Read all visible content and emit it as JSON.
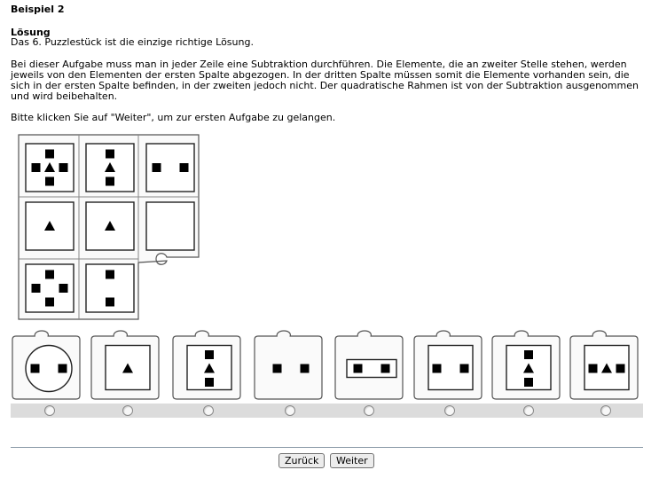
{
  "header": {
    "title": "Beispiel 2"
  },
  "solution": {
    "heading": "Lösung",
    "text": "Das 6. Puzzlestück ist die einzige richtige Lösung."
  },
  "explanation": "Bei dieser Aufgabe muss man in jeder Zeile eine Subtraktion durchführen. Die Elemente, die an zweiter Stelle stehen, werden jeweils von den Elementen der ersten Spalte abgezogen. In der dritten Spalte müssen somit die Elemente vorhanden sein, die sich in der ersten Spalte befinden, in der zweiten jedoch nicht. Der quadratische Rahmen ist von der Subtraktion ausgenommen und wird beibehalten.",
  "hint": "Bitte klicken Sie auf \"Weiter\", um zur ersten Aufgabe zu gelangen.",
  "puzzle": {
    "matrix_cells": [
      [
        "square-top",
        "square-left",
        "triangle",
        "square-right",
        "square-bottom"
      ],
      [
        "square-top",
        "triangle",
        "square-bottom"
      ],
      [
        "square-left",
        "square-right"
      ],
      [
        "triangle"
      ],
      [
        "triangle"
      ],
      [],
      [
        "square-top",
        "square-left",
        "square-right",
        "square-bottom"
      ],
      [
        "square-top",
        "square-bottom"
      ]
    ],
    "options": [
      {
        "number": 1,
        "frame": "circle",
        "elements": [
          "square-left",
          "square-right"
        ]
      },
      {
        "number": 2,
        "frame": "square",
        "elements": [
          "triangle"
        ]
      },
      {
        "number": 3,
        "frame": "square",
        "elements": [
          "square-top",
          "triangle",
          "square-bottom"
        ]
      },
      {
        "number": 4,
        "frame": "none",
        "elements": [
          "square-left",
          "square-right"
        ]
      },
      {
        "number": 5,
        "frame": "rectangle",
        "elements": [
          "square-left",
          "square-right"
        ]
      },
      {
        "number": 6,
        "frame": "square",
        "elements": [
          "square-left",
          "square-right"
        ]
      },
      {
        "number": 7,
        "frame": "square",
        "elements": [
          "square-top",
          "triangle",
          "square-bottom"
        ]
      },
      {
        "number": 8,
        "frame": "square",
        "elements": [
          "square-left",
          "triangle",
          "square-right"
        ]
      }
    ]
  },
  "buttons": {
    "back": "Zurück",
    "next": "Weiter"
  }
}
